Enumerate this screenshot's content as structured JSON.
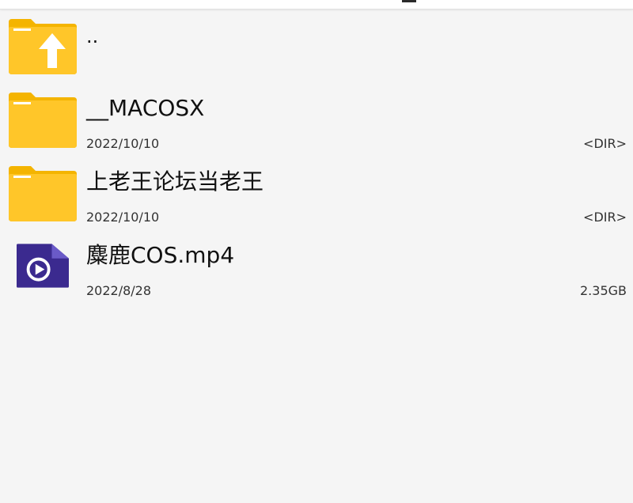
{
  "files": [
    {
      "name": "..",
      "icon": "folder-up-icon",
      "date": "",
      "size": ""
    },
    {
      "name": "__MACOSX",
      "icon": "folder-icon",
      "date": "2022/10/10",
      "size": "<DIR>"
    },
    {
      "name": "上老王论坛当老王",
      "icon": "folder-icon",
      "date": "2022/10/10",
      "size": "<DIR>"
    },
    {
      "name": "麋鹿COS.mp4",
      "icon": "video-file-icon",
      "date": "2022/8/28",
      "size": "2.35GB"
    }
  ],
  "colors": {
    "folder_front": "#FFC629",
    "folder_back": "#F4B400",
    "folder_tab_line": "#FFFFFF",
    "video_icon_body": "#3B2A8F",
    "video_icon_fold": "#6A5AC8",
    "background": "#F5F5F5",
    "text_primary": "#111111",
    "text_secondary": "#333333"
  }
}
